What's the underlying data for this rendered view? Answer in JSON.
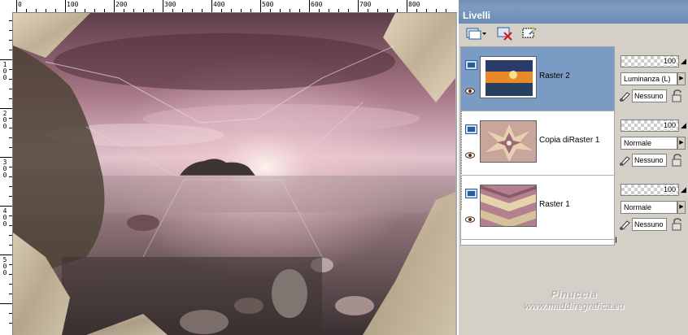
{
  "ruler": {
    "top_labels": [
      "0",
      "100",
      "200",
      "300",
      "400",
      "500",
      "600",
      "700",
      "800"
    ],
    "left_labels": [
      "1 0 0",
      "2 0 0",
      "3 0 0",
      "4 0 0",
      "5 0 0"
    ]
  },
  "panel": {
    "title": "Livelli",
    "toolbar_icons": [
      "new-layer-icon",
      "delete-layer-icon",
      "mask-icon"
    ]
  },
  "layers": [
    {
      "name": "Raster 2",
      "selected": true,
      "opacity": "100",
      "blend_mode": "Luminanza (L)",
      "mask": "Nessuno"
    },
    {
      "name": "Copia diRaster 1",
      "selected": false,
      "opacity": "100",
      "blend_mode": "Normale",
      "mask": "Nessuno"
    },
    {
      "name": "Raster 1",
      "selected": false,
      "opacity": "100",
      "blend_mode": "Normale",
      "mask": "Nessuno"
    }
  ],
  "watermark": {
    "line1": "Pinuccia",
    "line2": "www.maddiregrafica.eu"
  },
  "colors": {
    "selected_row": "#7a9bc4",
    "panel_title_bg": "#7e9cc0",
    "panel_bg": "#d4d0c8"
  }
}
